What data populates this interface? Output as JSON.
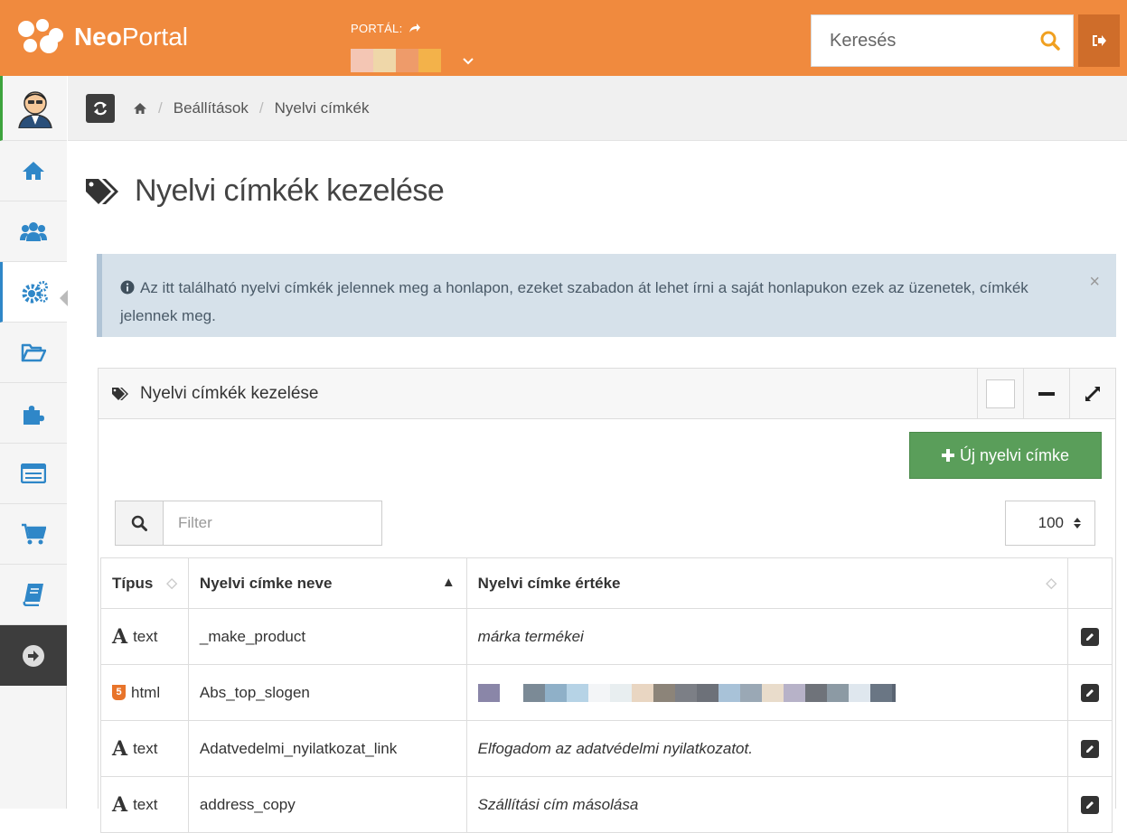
{
  "header": {
    "brand_bold": "Neo",
    "brand_rest": "Portal",
    "portal_label": "PORTÁL:",
    "search_placeholder": "Keresés"
  },
  "breadcrumb": {
    "items": [
      "Beállítások",
      "Nyelvi címkék"
    ]
  },
  "page": {
    "title": "Nyelvi címkék kezelése"
  },
  "alert": {
    "message": "Az itt található nyelvi címkék jelennek meg a honlapon, ezeket szabadon át lehet írni a saját honlapukon ezek az üzenetek, címkék jelennek meg.",
    "close": "×"
  },
  "panel": {
    "title": "Nyelvi címkék kezelése",
    "new_button": "Új nyelvi címke",
    "filter_placeholder": "Filter",
    "per_page": "100"
  },
  "table": {
    "headers": [
      "Típus",
      "Nyelvi címke neve",
      "Nyelvi címke értéke"
    ],
    "rows": [
      {
        "type": "text",
        "name": "_make_product",
        "value": "márka termékei"
      },
      {
        "type": "html",
        "name": "Abs_top_slogen",
        "value": ""
      },
      {
        "type": "text",
        "name": "Adatvedelmi_nyilatkozat_link",
        "value": "Elfogadom az adatvédelmi nyilatkozatot."
      },
      {
        "type": "text",
        "name": "address_copy",
        "value": "Szállítási cím másolása"
      }
    ]
  },
  "colors": {
    "topbar": "#f08a3e",
    "sidebar_active": "#2f87c8",
    "new_button": "#5a9e5a",
    "alert_bg": "#d6e1ea"
  }
}
